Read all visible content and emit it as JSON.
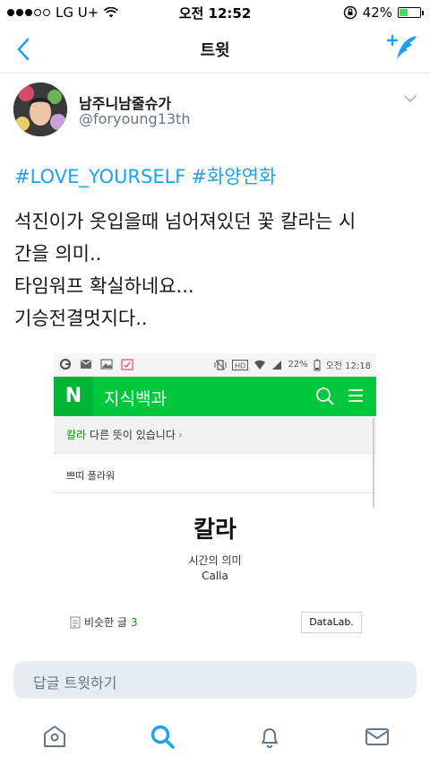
{
  "status_bar": {
    "carrier": "LG U+",
    "time": "오전 12:52",
    "battery": "42%",
    "battery_level": 0.42
  },
  "nav": {
    "title": "트윗"
  },
  "tweet": {
    "author_name": "남주니남줄슈가",
    "author_handle": "@foryoung13th",
    "hashtags": [
      "#LOVE_YOURSELF",
      "#화양연화"
    ],
    "lines": [
      "석진이가 옷입을때 넘어져있던 꽃 칼라는 시",
      "간을 의미..",
      "타임워프 확실하네요...",
      "기승전결멋지다.."
    ]
  },
  "media": {
    "status_time": "오전 12:18",
    "status_battery": "22%",
    "logo": "N",
    "header_title": "지식백과",
    "notice_keyword": "칼라",
    "notice_text": " 다른 뜻이 있습니다",
    "category": "쁘띠 플라워",
    "entry_title": "칼라",
    "entry_sub": "시간의 의미",
    "entry_en": "Calla",
    "similar_label": "비슷한 글",
    "similar_count": "3",
    "datalab": "DataLab."
  },
  "reply": {
    "placeholder": "답글 트윗하기"
  },
  "colors": {
    "twitter_blue": "#1da1f2",
    "naver_green": "#00c73c",
    "secondary_text": "#657786"
  },
  "icons": [
    "back-icon",
    "compose-tweet-icon",
    "chevron-down-icon",
    "home-icon",
    "search-icon",
    "notifications-icon",
    "messages-icon"
  ]
}
